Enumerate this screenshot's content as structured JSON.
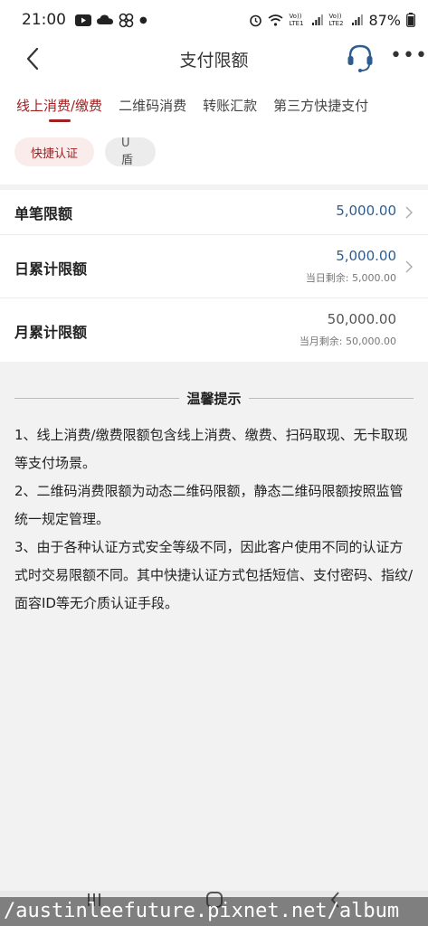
{
  "status_bar": {
    "time": "21:00",
    "network_labels": [
      "Vo)) LTE1",
      "Vo)) LTE2"
    ],
    "battery_percent": "87%"
  },
  "header": {
    "title": "支付限额"
  },
  "tabs": [
    {
      "label": "线上消费/缴费",
      "active": true
    },
    {
      "label": "二维码消费",
      "active": false
    },
    {
      "label": "转账汇款",
      "active": false
    },
    {
      "label": "第三方快捷支付",
      "active": false
    }
  ],
  "auth_chips": [
    {
      "label": "快捷认证",
      "active": true
    },
    {
      "label": "U盾",
      "active": false
    }
  ],
  "limits": {
    "single": {
      "label": "单笔限额",
      "value": "5,000.00"
    },
    "daily": {
      "label": "日累计限额",
      "value": "5,000.00",
      "remaining": "当日剩余: 5,000.00"
    },
    "monthly": {
      "label": "月累计限额",
      "value": "50,000.00",
      "remaining": "当月剩余: 50,000.00"
    }
  },
  "tips": {
    "title": "温馨提示",
    "items": [
      "1、线上消费/缴费限额包含线上消费、缴费、扫码取现、无卡取现等支付场景。",
      "2、二维码消费限额为动态二维码限额，静态二维码限额按照监管统一规定管理。",
      "3、由于各种认证方式安全等级不同，因此客户使用不同的认证方式时交易限额不同。其中快捷认证方式包括短信、支付密码、指纹/面容ID等无介质认证手段。"
    ]
  },
  "watermark": "/austinleefuture.pixnet.net/album",
  "colors": {
    "accent": "#a02020",
    "value_blue": "#2f5c8e"
  }
}
